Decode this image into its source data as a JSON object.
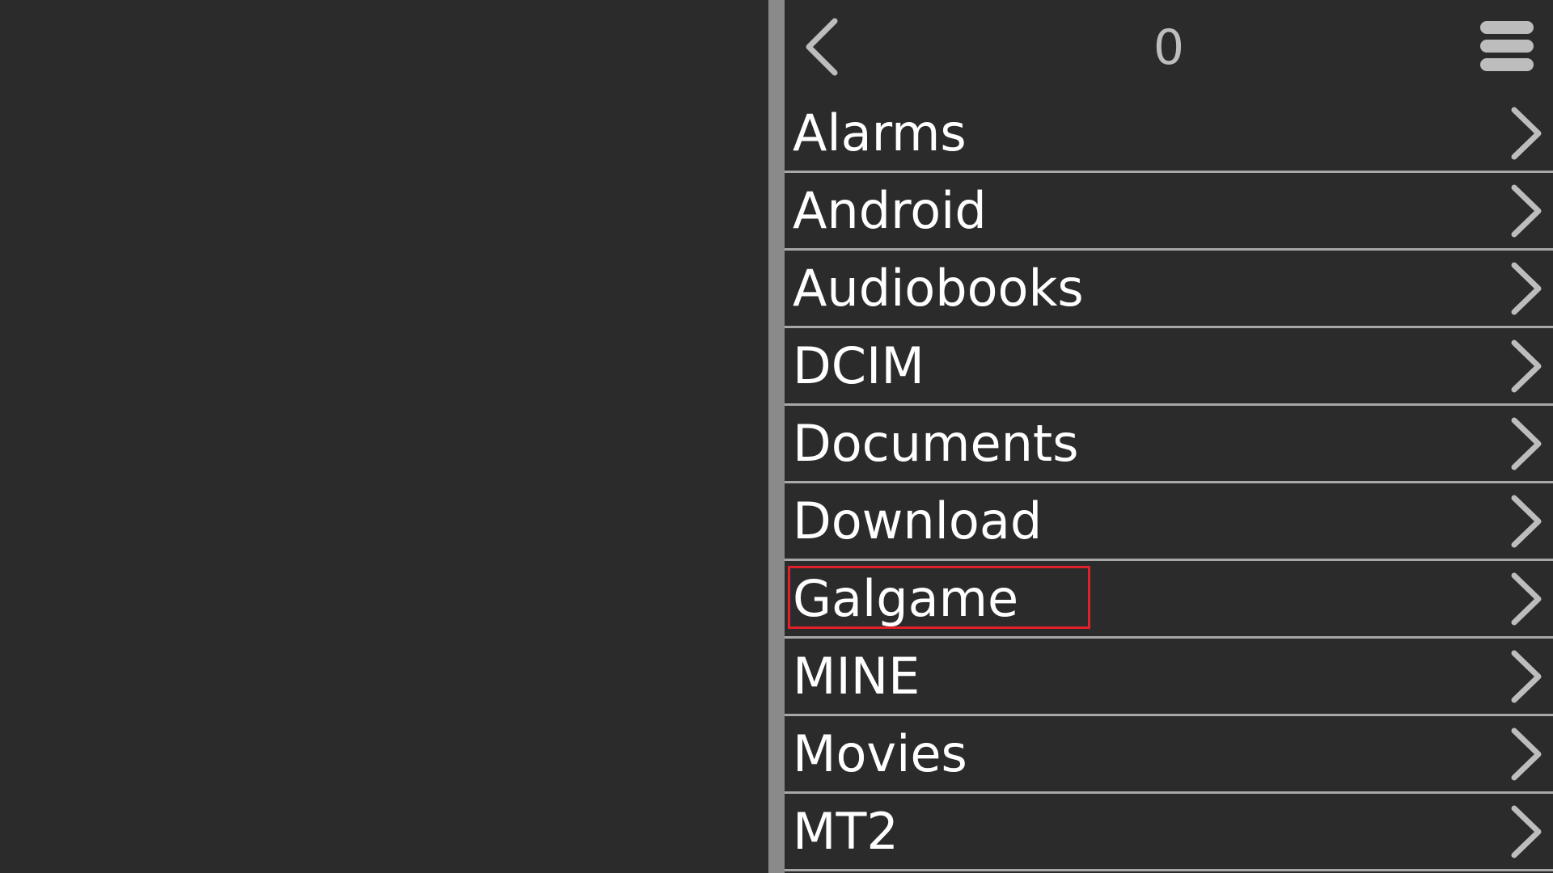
{
  "header": {
    "title": "0"
  },
  "icons": {
    "back": "back-chevron-icon",
    "menu": "hamburger-menu-icon",
    "row_arrow": "chevron-right-icon"
  },
  "colors": {
    "background": "#2b2b2b",
    "divider": "#8a8a8a",
    "text": "#ffffff",
    "row_separator": "#a8a8a8",
    "selection_outline": "#e0202a"
  },
  "folders": [
    {
      "name": "Alarms"
    },
    {
      "name": "Android"
    },
    {
      "name": "Audiobooks"
    },
    {
      "name": "DCIM"
    },
    {
      "name": "Documents"
    },
    {
      "name": "Download"
    },
    {
      "name": "Galgame",
      "selected": true
    },
    {
      "name": "MINE"
    },
    {
      "name": "Movies"
    },
    {
      "name": "MT2"
    }
  ]
}
